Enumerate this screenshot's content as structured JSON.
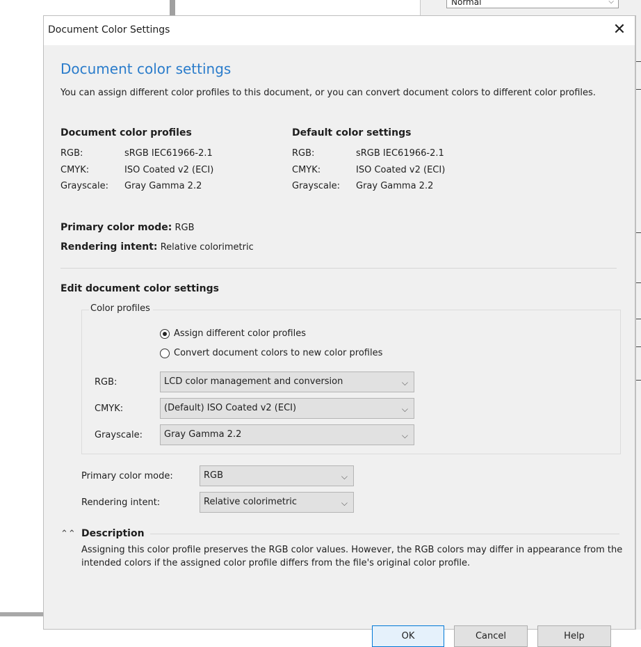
{
  "background": {
    "top_select_value": "Normal"
  },
  "dialog": {
    "title": "Document Color Settings",
    "close_glyph": "✕",
    "heading": "Document color settings",
    "intro": "You can assign different color profiles to this document, or you can convert document colors to different color profiles.",
    "document_profiles": {
      "title": "Document color profiles",
      "rows": [
        {
          "key": "RGB:",
          "value": "sRGB IEC61966-2.1"
        },
        {
          "key": "CMYK:",
          "value": "ISO Coated v2 (ECI)"
        },
        {
          "key": "Grayscale:",
          "value": "Gray Gamma 2.2"
        }
      ]
    },
    "default_settings": {
      "title": "Default color settings",
      "rows": [
        {
          "key": "RGB:",
          "value": "sRGB IEC61966-2.1"
        },
        {
          "key": "CMYK:",
          "value": "ISO Coated v2 (ECI)"
        },
        {
          "key": "Grayscale:",
          "value": "Gray Gamma 2.2"
        }
      ]
    },
    "primary_mode": {
      "label": "Primary color mode:",
      "value": "RGB"
    },
    "rendering_intent": {
      "label": "Rendering intent:",
      "value": "Relative colorimetric"
    },
    "edit": {
      "title": "Edit document color settings",
      "group_legend": "Color profiles",
      "radio_assign": "Assign different color profiles",
      "radio_convert": "Convert document colors to new color profiles",
      "selected_radio": "assign",
      "rgb_label": "RGB:",
      "rgb_value": "LCD color management and conversion",
      "cmyk_label": "CMYK:",
      "cmyk_value": "(Default) ISO Coated v2 (ECI)",
      "grayscale_label": "Grayscale:",
      "grayscale_value": "Gray Gamma 2.2",
      "primary_label": "Primary color mode:",
      "primary_value": "RGB",
      "intent_label": "Rendering intent:",
      "intent_value": "Relative colorimetric"
    },
    "description": {
      "title": "Description",
      "text": "Assigning this color profile preserves the RGB color values. However, the RGB colors may differ in appearance from the intended colors if the assigned color profile differs from the file's original color profile."
    },
    "buttons": {
      "ok": "OK",
      "cancel": "Cancel",
      "help": "Help"
    }
  },
  "colors": {
    "heading_blue": "#2a7ccb",
    "dialog_bg": "#f0f0f0",
    "default_button_border": "#0078d7"
  },
  "icons": {
    "close": "close-icon",
    "dropdown": "chevron-down-icon",
    "collapse": "chevron-up-double-icon"
  }
}
